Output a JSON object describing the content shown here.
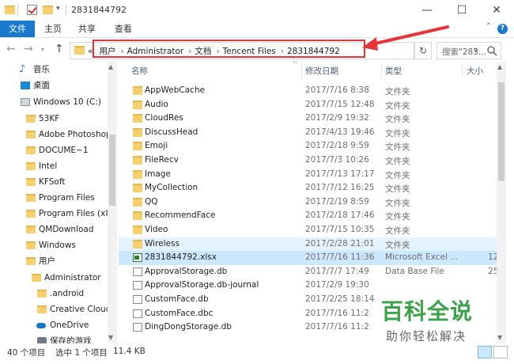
{
  "window": {
    "title": "2831844792",
    "buttons": {
      "minimize": "—",
      "maximize": "☐",
      "close": "✕"
    }
  },
  "ribbon": {
    "tabs": [
      "文件",
      "主页",
      "共享",
      "查看"
    ],
    "help": "?"
  },
  "nav": {
    "breadcrumb": [
      "用户",
      "Administrator",
      "文档",
      "Tencent Files",
      "2831844792"
    ],
    "search_placeholder": "搜索\"283...",
    "back_symbol": "«"
  },
  "sidebar": {
    "items": [
      {
        "label": "音乐",
        "icon": "music-icon",
        "indent": 1
      },
      {
        "label": "桌面",
        "icon": "desktop-icon",
        "indent": 1
      },
      {
        "label": "Windows 10 (C:)",
        "icon": "drive-icon",
        "indent": 1
      },
      {
        "label": "53KF",
        "icon": "folder-icon",
        "indent": 2
      },
      {
        "label": "Adobe Photoshop",
        "icon": "folder-icon",
        "indent": 2
      },
      {
        "label": "DOCUME~1",
        "icon": "folder-icon",
        "indent": 2
      },
      {
        "label": "Intel",
        "icon": "folder-icon",
        "indent": 2
      },
      {
        "label": "KFSoft",
        "icon": "folder-icon",
        "indent": 2
      },
      {
        "label": "Program Files",
        "icon": "folder-icon",
        "indent": 2
      },
      {
        "label": "Program Files (x8",
        "icon": "folder-icon",
        "indent": 2
      },
      {
        "label": "QMDownload",
        "icon": "folder-icon",
        "indent": 2
      },
      {
        "label": "Windows",
        "icon": "folder-icon",
        "indent": 2
      },
      {
        "label": "用户",
        "icon": "folder-icon",
        "indent": 2
      },
      {
        "label": "Administrator",
        "icon": "folder-icon",
        "indent": 3
      },
      {
        "label": ".android",
        "icon": "folder-icon",
        "indent": 4
      },
      {
        "label": "Creative Cloud",
        "icon": "creative-cloud-icon",
        "indent": 4
      },
      {
        "label": "OneDrive",
        "icon": "onedrive-icon",
        "indent": 4
      },
      {
        "label": "保存的游戏",
        "icon": "saved-games-icon",
        "indent": 4
      }
    ]
  },
  "table": {
    "columns": [
      "名称",
      "修改日期",
      "类型",
      "大小"
    ],
    "rows": [
      {
        "name": "AppWebCache",
        "date": "2017/7/16 8:38",
        "type": "文件夹",
        "size": "",
        "kind": "folder"
      },
      {
        "name": "Audio",
        "date": "2017/7/15 12:48",
        "type": "文件夹",
        "size": "",
        "kind": "folder"
      },
      {
        "name": "CloudRes",
        "date": "2017/2/9 19:32",
        "type": "文件夹",
        "size": "",
        "kind": "folder"
      },
      {
        "name": "DiscussHead",
        "date": "2017/4/13 19:46",
        "type": "文件夹",
        "size": "",
        "kind": "folder"
      },
      {
        "name": "Emoji",
        "date": "2017/2/18 9:59",
        "type": "文件夹",
        "size": "",
        "kind": "folder"
      },
      {
        "name": "FileRecv",
        "date": "2017/7/3 10:26",
        "type": "文件夹",
        "size": "",
        "kind": "folder"
      },
      {
        "name": "Image",
        "date": "2017/7/13 17:17",
        "type": "文件夹",
        "size": "",
        "kind": "folder"
      },
      {
        "name": "MyCollection",
        "date": "2017/7/12 16:25",
        "type": "文件夹",
        "size": "",
        "kind": "folder"
      },
      {
        "name": "QQ",
        "date": "2017/2/19 8:59",
        "type": "文件夹",
        "size": "",
        "kind": "folder"
      },
      {
        "name": "RecommendFace",
        "date": "2017/2/18 17:46",
        "type": "文件夹",
        "size": "",
        "kind": "folder"
      },
      {
        "name": "Video",
        "date": "2017/7/15 10:35",
        "type": "文件夹",
        "size": "",
        "kind": "folder"
      },
      {
        "name": "Wireless",
        "date": "2017/2/28 21:01",
        "type": "文件夹",
        "size": "",
        "kind": "folder",
        "state": "hover"
      },
      {
        "name": "2831844792.xlsx",
        "date": "2017/7/16 11:36",
        "type": "Microsoft Excel ...",
        "size": "12",
        "kind": "excel",
        "state": "selected"
      },
      {
        "name": "ApprovalStorage.db",
        "date": "2017/7/7 17:49",
        "type": "Data Base File",
        "size": "25",
        "kind": "doc"
      },
      {
        "name": "ApprovalStorage.db-journal",
        "date": "2017/2/9 19:30",
        "type": "",
        "size": "",
        "kind": "doc"
      },
      {
        "name": "CustomFace.db",
        "date": "2017/2/25 18:14",
        "type": "",
        "size": "",
        "kind": "doc"
      },
      {
        "name": "CustomFace.dbc",
        "date": "2017/7/16 11:2",
        "type": "",
        "size": "",
        "kind": "doc"
      },
      {
        "name": "DingDongStorage.db",
        "date": "2017/7/16 11:2",
        "type": "",
        "size": "",
        "kind": "doc"
      }
    ]
  },
  "status": {
    "count": "40 个项目",
    "selected": "选中 1 个项目",
    "size": "11.4 KB"
  },
  "watermark": {
    "main": "百科全说",
    "sub": "助你轻松解决"
  },
  "colors": {
    "accent": "#1979ca",
    "highlight_box": "#e5353b",
    "selected_row": "#cce8ff",
    "hover_row": "#e5f3ff",
    "watermark_green": "#3aa34a"
  }
}
